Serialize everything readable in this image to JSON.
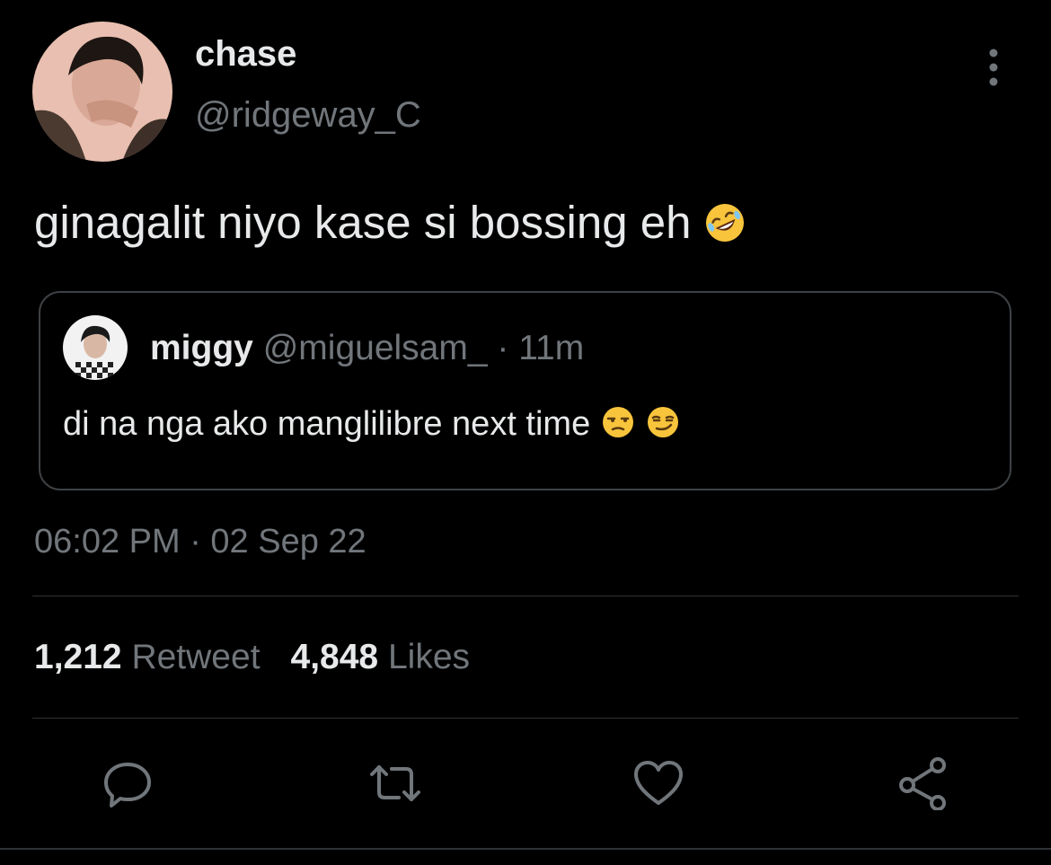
{
  "tweet": {
    "author": {
      "display_name": "chase",
      "handle": "@ridgeway_C",
      "avatar_icon": "user-photo"
    },
    "text": "ginagalit niyo kase si bossing eh",
    "text_emoji": "rolling-on-the-floor-laughing-emoji",
    "more_icon": "more-vertical-icon",
    "quoted": {
      "display_name": "miggy",
      "handle": "@miguelsam_",
      "separator": "·",
      "time": "11m",
      "text": "di na nga ako manglilibre next time",
      "emojis": [
        "unamused-face-emoji",
        "smirking-face-emoji"
      ]
    },
    "timestamp": "06:02 PM · 02 Sep 22",
    "stats": {
      "retweet_count": "1,212",
      "retweet_label": "Retweet",
      "like_count": "4,848",
      "like_label": "Likes"
    },
    "actions": [
      "reply-icon",
      "retweet-icon",
      "like-icon",
      "share-icon"
    ]
  },
  "colors": {
    "background": "#000000",
    "primary_text": "#e7e9ea",
    "secondary_text": "#71767b",
    "border": "#2f3336"
  }
}
